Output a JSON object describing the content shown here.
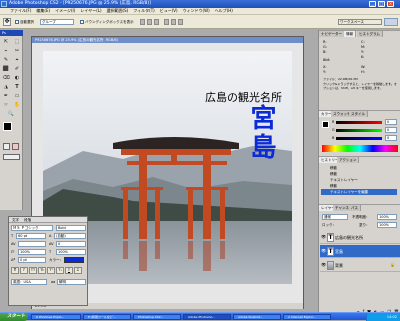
{
  "window": {
    "title": "Adobe Photoshop CS2 - [P9250676.JPG @ 25.9% (広島, RGB/8)]",
    "controls": [
      "_",
      "□",
      "×"
    ]
  },
  "menu": [
    "ファイル(F)",
    "編集(E)",
    "イメージ(I)",
    "レイヤー(L)",
    "選択範囲(S)",
    "フィルタ(T)",
    "ビュー(V)",
    "ウィンドウ(W)",
    "ヘルプ(H)"
  ],
  "options": {
    "auto_select": "自動選択",
    "group_value": "グループ",
    "bounding_box": "バウンディングボックスを表示",
    "workspace": "ワークスペース"
  },
  "toolbox": {
    "title": "Ps",
    "tools": [
      "⇱",
      "⬚",
      "⌁",
      "✂",
      "✎",
      "⌖",
      "⬛",
      "✐",
      "⌫",
      "◐",
      "◮",
      "T",
      "✒",
      "▭",
      "☞",
      "✋",
      "🔍"
    ]
  },
  "document": {
    "title": "P9250676.JPG @ 25.9% (広島の観光名所, RGB/8)",
    "caption": "広島の観光名所",
    "big_text": "宮島",
    "status": "25.9%"
  },
  "character": {
    "tabs": [
      "文字",
      "段落"
    ],
    "font": "ＭＳ Ｐゴシック",
    "style": "Bold",
    "size": "60 pt",
    "leading": "(自動)",
    "tracking": "0",
    "scale_v": "100%",
    "scale_h": "100%",
    "baseline": "0 pt",
    "color_label": "カラー：",
    "lang": "英語：USA",
    "aa": "aa",
    "aa_value": "鮮明",
    "style_buttons": [
      "T",
      "T",
      "TT",
      "Tt",
      "T¹",
      "T₁",
      "T",
      "T̶"
    ]
  },
  "navigator": {
    "tabs": [
      "ナビゲーター",
      "情報",
      "ヒストグラム"
    ],
    "values": [
      "R:",
      "G:",
      "B:",
      "C:",
      "M:",
      "Y:",
      "K:",
      "8bit",
      "X:",
      "Y:",
      "W:",
      "H:",
      "ファイル：22.9M/26.3M"
    ],
    "hint": "クリック&ドラッグすると、レイヤーを移動します。オプションは、Shift、Alt キーを使用します。"
  },
  "color": {
    "tabs": [
      "カラー",
      "スウォッチ",
      "スタイル"
    ],
    "channels": [
      {
        "name": "R",
        "value": "0"
      },
      {
        "name": "G",
        "value": "0"
      },
      {
        "name": "B",
        "value": "0"
      }
    ],
    "accent": "#0a2bd6"
  },
  "history": {
    "tabs": [
      "ヒストリー",
      "アクション"
    ],
    "items": [
      "移動",
      "移動",
      "テキストレイヤー",
      "移動",
      "テキストレイヤーを編集"
    ],
    "selected_index": 4
  },
  "layers": {
    "tabs": [
      "レイヤー",
      "チャンネル",
      "パス"
    ],
    "mode": "通常",
    "opacity_label": "不透明度：",
    "opacity": "100%",
    "fill_label": "塗り：",
    "fill": "100%",
    "lock_label": "ロック：",
    "items": [
      {
        "name": "広島の観光名所",
        "type": "T",
        "selected": false
      },
      {
        "name": "宮島",
        "type": "T",
        "selected": true
      },
      {
        "name": "背景",
        "type": "img",
        "selected": false,
        "locked": true
      }
    ]
  },
  "taskbar": {
    "start": "スタート",
    "tasks": [
      "6 Windows Explo...",
      "E:\\商用ツールなど...",
      "Photoshop CS2...",
      "Adobe Photosho...",
      "Adobe Illustrat...",
      "2 Internet Explor..."
    ],
    "active_index": 3,
    "clock": "14:02"
  }
}
